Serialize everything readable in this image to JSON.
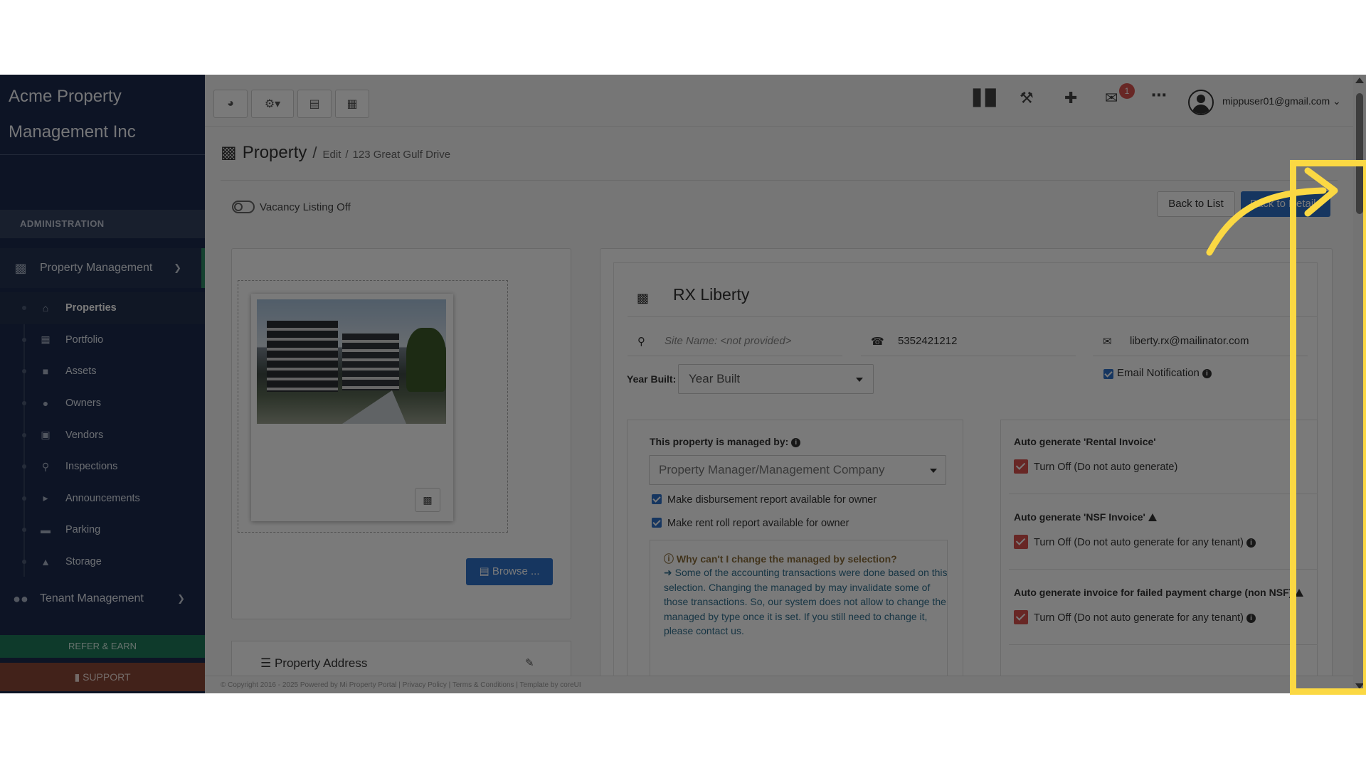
{
  "brand": {
    "line1": "Acme Property",
    "line2": "Management Inc"
  },
  "sidebar": {
    "section_label": "ADMINISTRATION",
    "group_property": "Property Management",
    "group_tenant": "Tenant Management",
    "items": [
      {
        "label": "Properties",
        "icon": "home-icon"
      },
      {
        "label": "Portfolio",
        "icon": "portfolio-icon"
      },
      {
        "label": "Assets",
        "icon": "assets-icon"
      },
      {
        "label": "Owners",
        "icon": "user-icon"
      },
      {
        "label": "Vendors",
        "icon": "briefcase-icon"
      },
      {
        "label": "Inspections",
        "icon": "search-icon"
      },
      {
        "label": "Announcements",
        "icon": "megaphone-icon"
      },
      {
        "label": "Parking",
        "icon": "car-icon"
      },
      {
        "label": "Storage",
        "icon": "basket-icon"
      }
    ],
    "refer_label": "REFER & EARN",
    "support_label": "SUPPORT"
  },
  "topbar": {
    "mail_badge": "1",
    "user_email": "mippuser01@gmail.com"
  },
  "breadcrumb": {
    "title": "Property",
    "sep": "/",
    "edit": "Edit",
    "sep2": "/",
    "address": "123 Great Gulf Drive"
  },
  "vacancy": {
    "label": "Vacancy Listing Off"
  },
  "actions": {
    "back": "Back to List",
    "details": "Back to Details"
  },
  "image_panel": {
    "browse": "Browse ..."
  },
  "address_panel": {
    "title": "Property Address"
  },
  "property": {
    "name": "RX Liberty",
    "site_name_placeholder": "Site Name: <not provided>",
    "phone": "5352421212",
    "email": "liberty.rx@mailinator.com",
    "email_notification": "Email Notification",
    "year_built_label": "Year Built:",
    "year_built_value": "Year Built"
  },
  "managed": {
    "title": "This property is managed by:",
    "select_value": "Property Manager/Management Company",
    "cb1": "Make disbursement report available for owner",
    "cb2": "Make rent roll report available for owner",
    "why_title": "Why can't I change the managed by selection?",
    "why_text": "Some of the accounting transactions were done based on this selection. Changing the managed by may invalidate some of those transactions. So, our system does not allow to change the managed by type once it is set. If you still need to change it, please contact us."
  },
  "auto": {
    "rental_title": "Auto generate 'Rental Invoice'",
    "rental_opt": "Turn Off (Do not auto generate)",
    "nsf_title": "Auto generate 'NSF Invoice'",
    "nsf_opt": "Turn Off (Do not auto generate for any tenant)",
    "failed_title": "Auto generate invoice for failed payment charge (non NSF)",
    "failed_opt": "Turn Off (Do not auto generate for any tenant)"
  },
  "footer": {
    "text": "© Copyright 2016 - 2025 Powered by Mi Property Portal | Privacy Policy | Terms & Conditions | Template by coreUI"
  },
  "colors": {
    "sidebar": "#1d2b4f",
    "accent_blue": "#2f72c9",
    "highlight": "#fbd843",
    "check_red": "#d9534f"
  }
}
